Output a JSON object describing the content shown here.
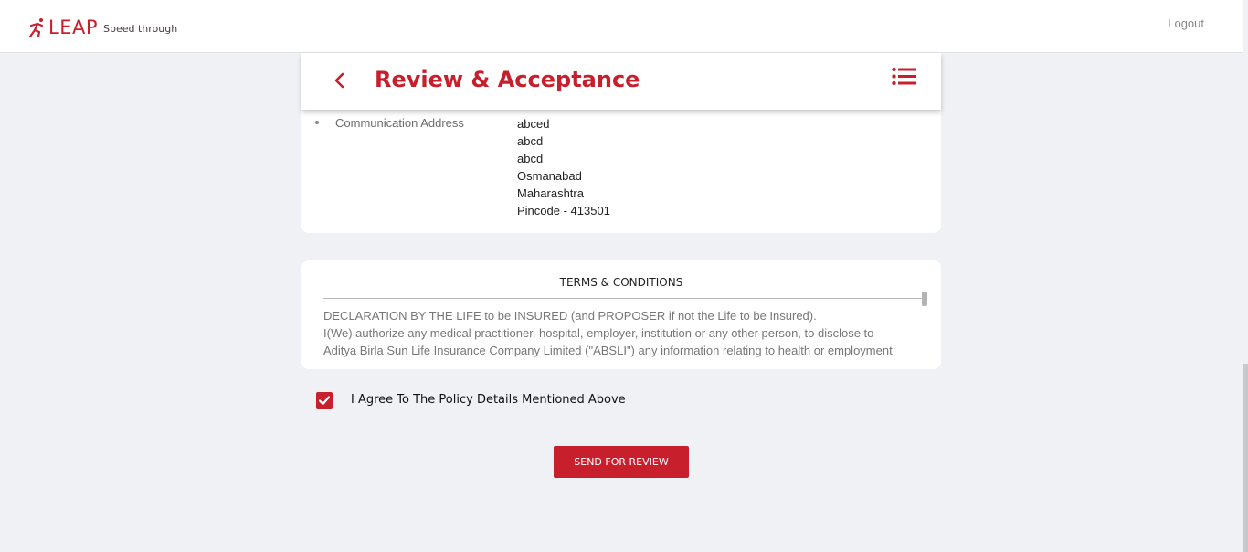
{
  "brand": {
    "name": "LEAP",
    "tagline": "Speed through",
    "accent_color": "#c81f2d"
  },
  "header": {
    "logout_label": "Logout"
  },
  "page": {
    "title": "Review & Acceptance",
    "back_icon": "chevron-left-icon",
    "menu_icon": "list-menu-icon"
  },
  "details": {
    "communication_address": {
      "label": "Communication Address",
      "lines": [
        "abced",
        "abcd",
        "abcd",
        "Osmanabad",
        "Maharashtra",
        "Pincode - 413501"
      ]
    }
  },
  "terms": {
    "title": "TERMS & CONDITIONS",
    "lines": [
      "DECLARATION BY THE LIFE to be INSURED (and PROPOSER if not the Life to be Insured).",
      "I(We) authorize any medical practitioner, hospital, employer, institution or any other person, to disclose to",
      "Aditya Birla Sun Life Insurance Company Limited (\"ABSLI\") any information relating to health or employment"
    ]
  },
  "agreement": {
    "label": "I Agree To The Policy Details Mentioned Above",
    "checked": true
  },
  "actions": {
    "send_label": "SEND FOR REVIEW"
  }
}
